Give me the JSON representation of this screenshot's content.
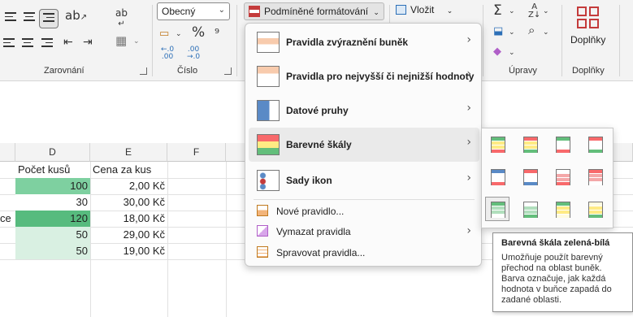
{
  "ribbon": {
    "groups": {
      "alignment": "Zarovnání",
      "number": "Číslo",
      "editing": "Úpravy",
      "addins": "Doplňky"
    },
    "number_format": "Obecný",
    "conditional_formatting": "Podmíněné formátování",
    "insert": "Vložit",
    "addins_button": "Doplňky",
    "percent_icon": "%"
  },
  "menu": {
    "items": [
      {
        "label": "Pravidla zvýraznění buněk",
        "icon": "highlight-rules-icon"
      },
      {
        "label": "Pravidla pro nejvyšší či nejnižší hodnoty",
        "icon": "top-bottom-icon"
      },
      {
        "label": "Datové pruhy",
        "icon": "data-bars-icon"
      },
      {
        "label": "Barevné škály",
        "icon": "color-scales-icon"
      },
      {
        "label": "Sady ikon",
        "icon": "icon-sets-icon"
      }
    ],
    "small_items": [
      {
        "label": "Nové pravidlo...",
        "icon": "new-rule-icon"
      },
      {
        "label": "Vymazat pravidla",
        "icon": "clear-rules-icon"
      },
      {
        "label": "Spravovat pravidla...",
        "icon": "manage-rules-icon"
      }
    ]
  },
  "sheet": {
    "columns": [
      "D",
      "E",
      "F"
    ],
    "headers": {
      "D": "Počet kusů",
      "E": "Cena za  kus"
    },
    "rows": [
      {
        "left": "",
        "d": "100",
        "e": "2,00 Kč"
      },
      {
        "left": "",
        "d": "30",
        "e": "30,00 Kč"
      },
      {
        "left": "ce",
        "d": "120",
        "e": "18,00 Kč"
      },
      {
        "left": "",
        "d": "50",
        "e": "29,00 Kč"
      },
      {
        "left": "",
        "d": "50",
        "e": "19,00 Kč"
      }
    ],
    "scale_colors": [
      "#7ed0a0",
      "#ffffff",
      "#57bb7e",
      "#d9f0e2",
      "#d9f0e2"
    ]
  },
  "tooltip": {
    "title": "Barevná škála zelená-bílá",
    "body": "Umožňuje použít barevný přechod na oblast buněk. Barva označuje, jak každá hodnota v buňce zapadá do zadané oblasti."
  },
  "colors": {
    "green": "#63be7b",
    "red": "#f8696b",
    "yellow": "#ffeb84",
    "blue": "#5a8ac6",
    "accent_red": "#c43b3b"
  }
}
